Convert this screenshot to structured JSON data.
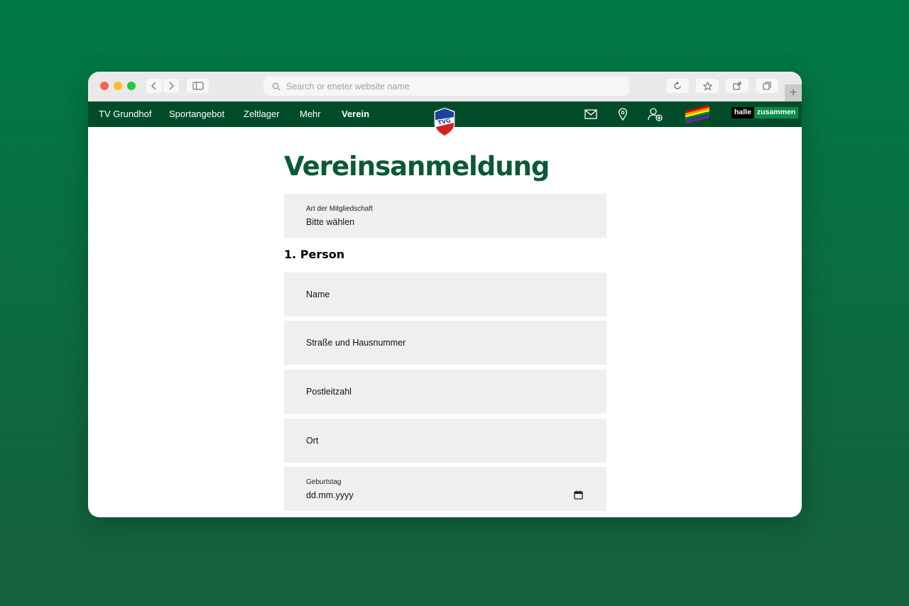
{
  "browser": {
    "address_placeholder": "Search or eneter website name"
  },
  "site": {
    "nav": [
      "TV Grundhof",
      "Sportangebot",
      "Zeltlager",
      "Mehr",
      "Verein"
    ],
    "active_nav": "Verein",
    "logo_text": "TVG",
    "partner_badge": {
      "part1": "halle",
      "part2": "zusammen"
    },
    "icons": [
      "mail-icon",
      "location-pin-icon",
      "add-user-icon",
      "rainbow-flag-icon"
    ]
  },
  "page": {
    "title": "Vereinsanmeldung",
    "membership": {
      "label": "Art der Mitgliedschaft",
      "value": "Bitte wählen"
    },
    "section_title": "1. Person",
    "fields": {
      "name": "Name",
      "street": "Straße und Hausnummer",
      "zip": "Postleitzahl",
      "city": "Ort"
    },
    "birthday": {
      "label": "Geburtstag",
      "value": "dd.mm.yyyy"
    }
  },
  "colors": {
    "background": "#007a45",
    "nav_bar": "#004c2a",
    "title": "#0a5a35",
    "field_bg": "#efefef"
  }
}
